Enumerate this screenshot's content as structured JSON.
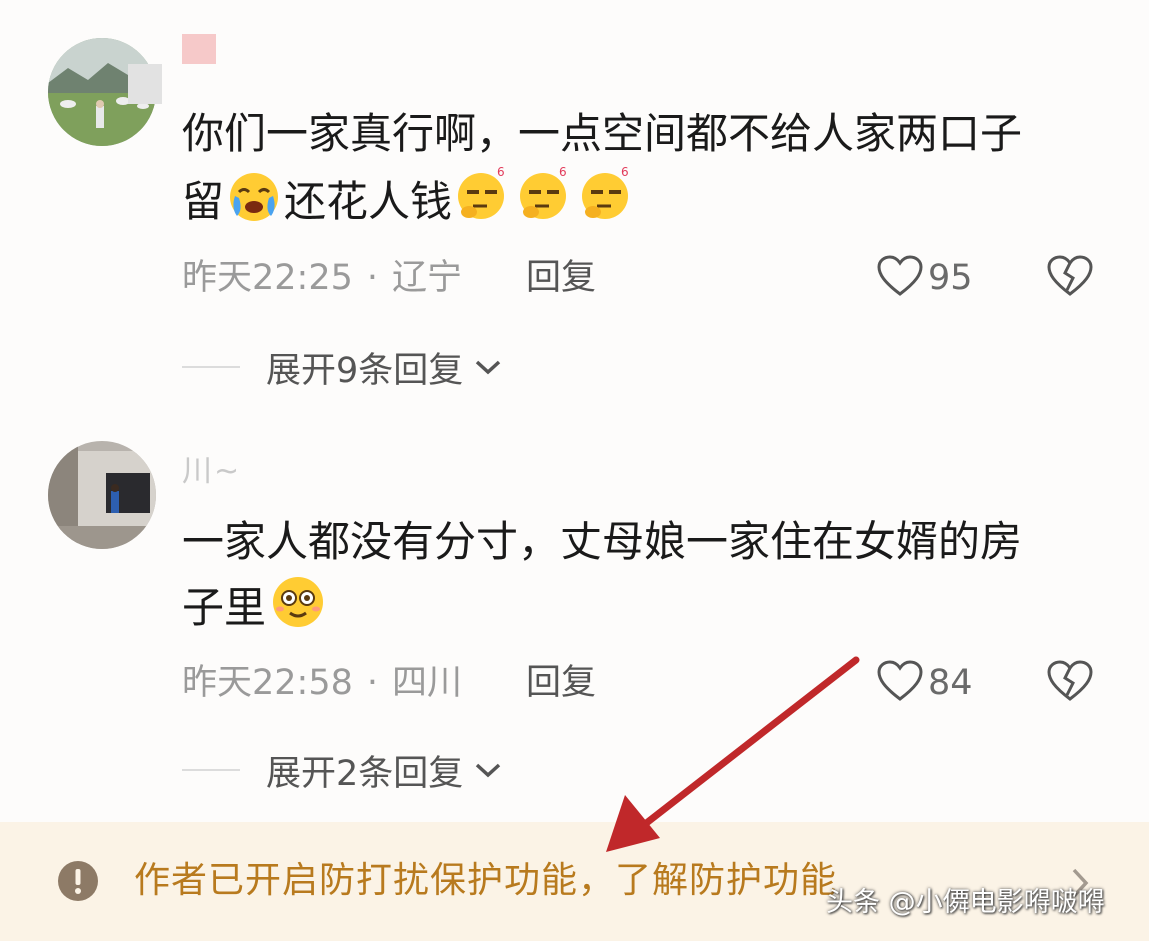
{
  "comments": [
    {
      "username": "",
      "text_line1": "你们一家真行啊，一点空间都不给人家两口子",
      "text_line2a": "留",
      "text_line2b": "还花人钱",
      "time": "昨天22:25",
      "location": "辽宁",
      "reply_label": "回复",
      "likes": "95",
      "expand_label": "展开9条回复"
    },
    {
      "username": "川~",
      "text_line1": "一家人都没有分寸，丈母娘一家住在女婿的房",
      "text_line2a": "子里",
      "text_line2b": "",
      "time": "昨天22:58",
      "location": "四川",
      "reply_label": "回复",
      "likes": "84",
      "expand_label": "展开2条回复"
    }
  ],
  "meta_separator": "·",
  "notice": {
    "text": "作者已开启防打扰保护功能，了解防护功能"
  },
  "watermark": "头条 @小僲电影嘚啵嘚",
  "colors": {
    "notice_bg": "#fbf3e6",
    "notice_text": "#b87a1e",
    "arrow": "#c0282a"
  },
  "icons": [
    "heart-icon",
    "broken-heart-icon",
    "chevron-down-icon",
    "warning-icon",
    "chevron-right-icon",
    "crying-emoji",
    "eye-roll-emoji",
    "smile-emoji"
  ]
}
